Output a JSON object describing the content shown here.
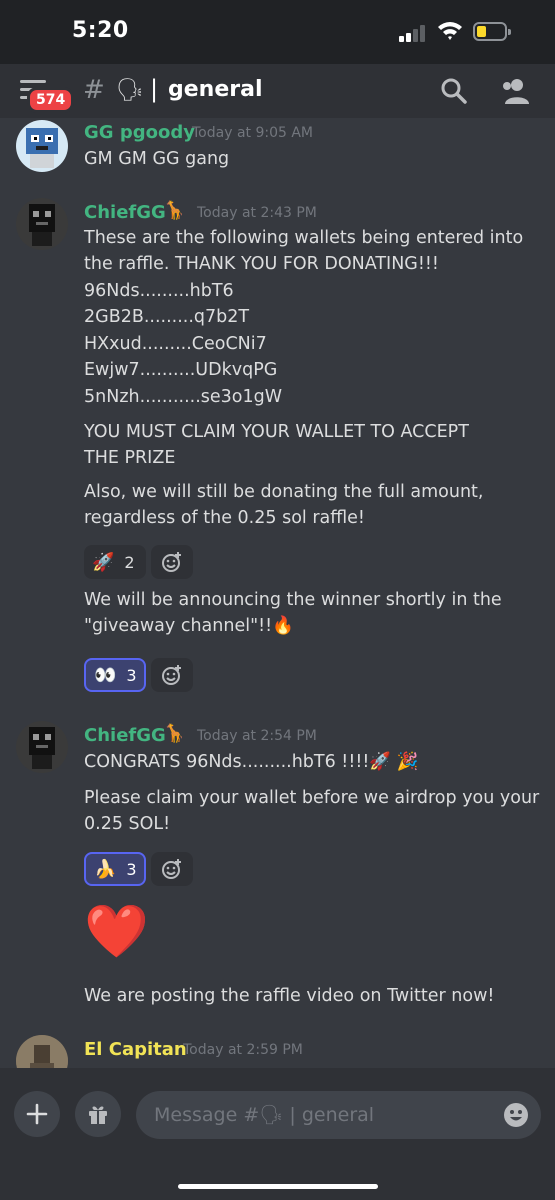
{
  "status_bar": {
    "time": "5:20"
  },
  "header": {
    "unread_badge": "574",
    "hash": "#",
    "channel_emoji": "🗣",
    "channel_separator": "|",
    "channel_name": "general"
  },
  "messages": [
    {
      "author": "GG pgoody",
      "author_color": "#43b581",
      "author_emoji": "",
      "timestamp": "Today at 9:05 AM",
      "lines": [
        "GM GM GG gang"
      ]
    },
    {
      "author": "ChiefGG",
      "author_color": "#43b581",
      "author_emoji": "🦒",
      "timestamp": "Today at 2:43 PM",
      "lines": [
        "These are the following wallets being entered into",
        "the raffle. THANK YOU FOR DONATING!!!",
        "96Nds.........hbT6",
        "2GB2B.........q7b2T",
        "HXxud.........CeoCNi7",
        "Ewjw7..........UDkvqPG",
        "5nNzh...........se3o1gW",
        "YOU MUST CLAIM YOUR WALLET TO ACCEPT",
        "THE PRIZE",
        "Also, we will still be donating the full amount,",
        "regardless of the 0.25 sol raffle!"
      ],
      "reaction_1": {
        "emoji": "🚀",
        "count": "2"
      },
      "followup_lines": [
        "We will be announcing the winner shortly in the",
        "\"giveaway channel\"!!🔥"
      ],
      "reaction_2": {
        "emoji": "👀",
        "count": "3"
      }
    },
    {
      "author": "ChiefGG",
      "author_color": "#43b581",
      "author_emoji": "🦒",
      "timestamp": "Today at 2:54 PM",
      "lines": [
        "CONGRATS 96Nds.........hbT6 !!!!🚀 🎉"
      ],
      "followup_lines": [
        "Please claim your wallet before we airdrop you your",
        "0.25 SOL!"
      ],
      "reaction_1": {
        "emoji": "🍌",
        "count": "3"
      },
      "heart": "❤️",
      "after_heart": "We are posting the raffle video on Twitter now!"
    },
    {
      "author": "El Capitan",
      "author_color": "#f1e356",
      "author_emoji": "",
      "timestamp": "Today at 2:59 PM"
    }
  ],
  "input": {
    "placeholder": "Message #🗣 | general"
  },
  "colors": {
    "accent": "#5865f2",
    "danger": "#ed4245",
    "battery": "#fcd92b"
  }
}
